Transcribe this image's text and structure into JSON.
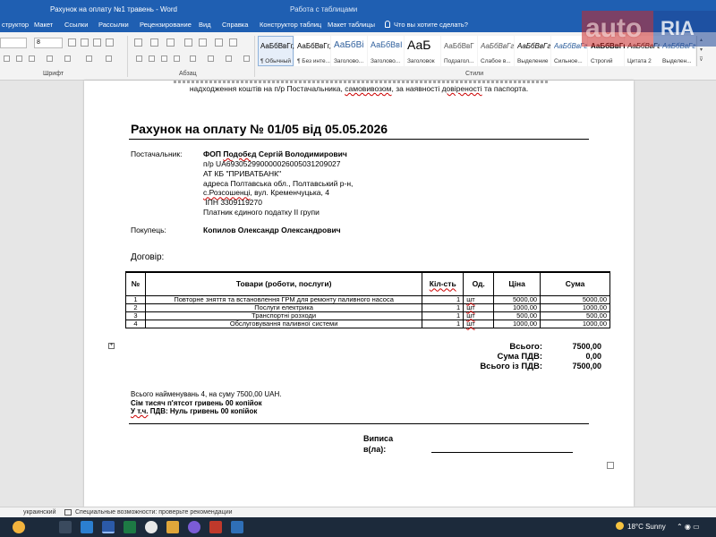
{
  "window": {
    "doc_title": "Рахунок на оплату №1 травень - Word",
    "context_label": "Работа с таблицами"
  },
  "tabs": [
    "структор",
    "Макет",
    "Ссылки",
    "Рассылки",
    "Рецензирование",
    "Вид",
    "Справка",
    "Конструктор таблиц",
    "Макет таблицы"
  ],
  "tellme": "Что вы хотите сделать?",
  "ribbon": {
    "font_name": "",
    "font_size": "8",
    "group_font": "Шрифт",
    "group_paragraph": "Абзац",
    "group_styles": "Стили",
    "styles": [
      {
        "sample": "АаБбВвГг,",
        "name": "¶ Обычный"
      },
      {
        "sample": "АаБбВвГг,",
        "name": "¶ Без инте..."
      },
      {
        "sample": "АаБбВі",
        "name": "Заголово..."
      },
      {
        "sample": "АаБбВвІ",
        "name": "Заголово..."
      },
      {
        "sample": "АаБ",
        "name": "Заголовок"
      },
      {
        "sample": "АаБбВвГ",
        "name": "Подзагол..."
      },
      {
        "sample": "АаБбВвГг",
        "name": "Слабое в..."
      },
      {
        "sample": "АаБбВвГг",
        "name": "Выделение"
      },
      {
        "sample": "АаБбВвГг",
        "name": "Сильное..."
      },
      {
        "sample": "АаБбВвГг",
        "name": "Строгий"
      },
      {
        "sample": "АаБбВвГг",
        "name": "Цитата 2"
      },
      {
        "sample": "АаБбВвГг",
        "name": "Выделен..."
      }
    ]
  },
  "watermark": {
    "left": "auto",
    "right": "RIA"
  },
  "document": {
    "intro_line1": "надходження коштів на п/р Постачальника,",
    "intro_u1": "самовивозом",
    "intro_mid": ", за наявності",
    "intro_u2": "довіреності",
    "intro_end": "та паспорта.",
    "title": "Рахунок на оплату № 01/05 від 05.05.2026",
    "supplier_label": "Постачальник:",
    "supplier": {
      "line1_pre": "ФОП",
      "line1_u": "Подобєд",
      "line1_post": "Сергій Володимирович",
      "line2": "п/р UA693052990000026005031209027",
      "line3": "АТ КБ \"ПРИВАТБАНК\"",
      "line4": "адреса Полтавська обл., Полтавський р-н,",
      "line5_u": "с.Розсошенці",
      "line5_post": ", вул. Кременчуцька, 4",
      "line6": " ІПН 3309119270",
      "line7": "Платник єдиного податку ІІ групи"
    },
    "buyer_label": "Покупець:",
    "buyer": "Копилов Олександр Олександрович",
    "contract_label": "Договір:",
    "table": {
      "headers": [
        "№",
        "Товари (роботи, послуги)",
        "Кіл-сть",
        "Од.",
        "Ціна",
        "Сума"
      ],
      "rows": [
        [
          "1",
          "Повторне зняття та встановлення ГРМ для ремонту паливного насоса",
          "1",
          "шт",
          "5000,00",
          "5000,00"
        ],
        [
          "2",
          "Послуги електрика",
          "1",
          "шт",
          "1000,00",
          "1000,00"
        ],
        [
          "3",
          "Транспортні розходи",
          "1",
          "шт",
          "500,00",
          "500,00"
        ],
        [
          "4",
          "Обслуговування паливної системи",
          "1",
          "шт",
          "1000,00",
          "1000,00"
        ]
      ]
    },
    "totals": {
      "total_label": "Всього:",
      "total_value": "7500,00",
      "vat_label": "Сума ПДВ:",
      "vat_value": "0,00",
      "grand_label": "Всього із ПДВ:",
      "grand_value": "7500,00"
    },
    "summary_line1": "Всього найменувань 4, на суму 7500,00 UAH.",
    "summary_line2": "Сім тисяч п'ятсот гривень 00 копійок",
    "summary_line3_u": "У т.ч.",
    "summary_line3_post": " ПДВ: Нуль гривень 00 копійок",
    "signature_label": "Виписа\nв(ла):"
  },
  "statusbar": {
    "language": "украинский",
    "accessibility": "Специальные возможности: проверьте рекомендации"
  },
  "taskbar": {
    "weather": "18°C Sunny"
  },
  "colors": {
    "title_bar": "#1f5fb2",
    "taskbar": "#1c2a3b",
    "spell_underline": "#cc0000"
  }
}
